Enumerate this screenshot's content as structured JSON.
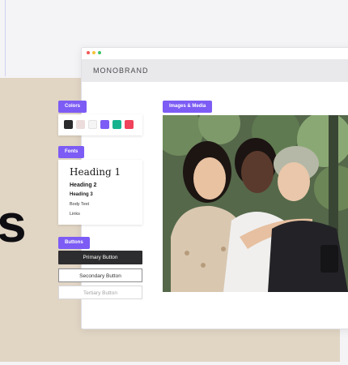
{
  "window": {
    "traffic_colors": [
      "#f25858",
      "#f5c23a",
      "#3dc46a"
    ]
  },
  "brand": {
    "name": "MONOBRAND"
  },
  "colors_section": {
    "label": "Colors",
    "swatches": [
      "#2a2a2c",
      "#ecdcdc",
      "#f5f5f5",
      "#7c5cf4",
      "#17b38f",
      "#f0425a"
    ]
  },
  "fonts_section": {
    "label": "Fonts",
    "heading1": "Heading 1",
    "heading2": "Heading 2",
    "heading3": "Heading 3",
    "body_text": "Body Text",
    "links": "Links"
  },
  "buttons_section": {
    "label": "Buttons",
    "primary": "Primary Button",
    "secondary": "Secondary Button",
    "tertiary": "Tertiary Button"
  },
  "media_section": {
    "label": "Images & Media"
  },
  "hero": {
    "letter": "s"
  },
  "palette": {
    "accent": "#7c5cf4",
    "beige": "#e0d4c3"
  }
}
